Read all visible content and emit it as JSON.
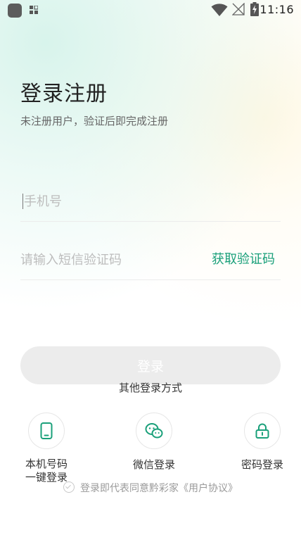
{
  "status_bar": {
    "time": "11:16"
  },
  "header": {
    "title": "登录注册",
    "subtitle": "未注册用户，验证后即完成注册"
  },
  "form": {
    "phone_placeholder": "手机号",
    "phone_value": "",
    "code_placeholder": "请输入短信验证码",
    "code_value": "",
    "get_code_label": "获取验证码",
    "login_label": "登录"
  },
  "other_login": {
    "heading": "其他登录方式",
    "options": [
      {
        "label": "本机号码\n一键登录",
        "icon": "phone-icon"
      },
      {
        "label": "微信登录",
        "icon": "wechat-icon"
      },
      {
        "label": "密码登录",
        "icon": "lock-icon"
      }
    ]
  },
  "agreement": {
    "text": "登录即代表同意黔彩家《用户协议》"
  },
  "colors": {
    "accent": "#1aa07a",
    "button_disabled": "#ececec",
    "placeholder": "#bdbdbd"
  }
}
